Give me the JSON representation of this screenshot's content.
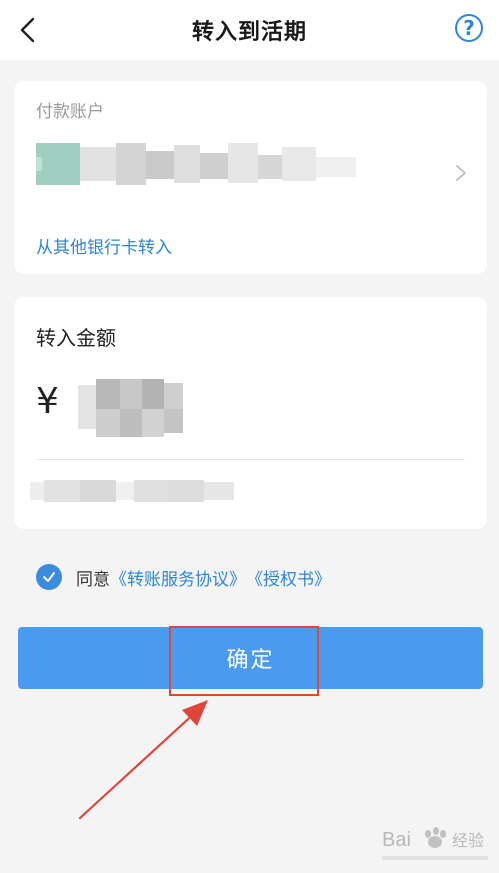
{
  "header": {
    "title": "转入到活期",
    "back_icon": "chevron-left-icon",
    "help_icon": "question-mark-icon",
    "help_glyph": "?"
  },
  "account_card": {
    "label": "付款账户",
    "link": "从其他银行卡转入"
  },
  "amount_card": {
    "label": "转入金额",
    "currency": "¥"
  },
  "agreement": {
    "prefix": "同意",
    "link1": "《转账服务协议》",
    "link2": "《授权书》"
  },
  "confirm_button": {
    "label": "确定"
  },
  "watermark": {
    "text": "Bai",
    "text2": "经验"
  },
  "colors": {
    "accent": "#2f86d6",
    "button": "#4a9bf0",
    "highlight": "#e0453a"
  }
}
